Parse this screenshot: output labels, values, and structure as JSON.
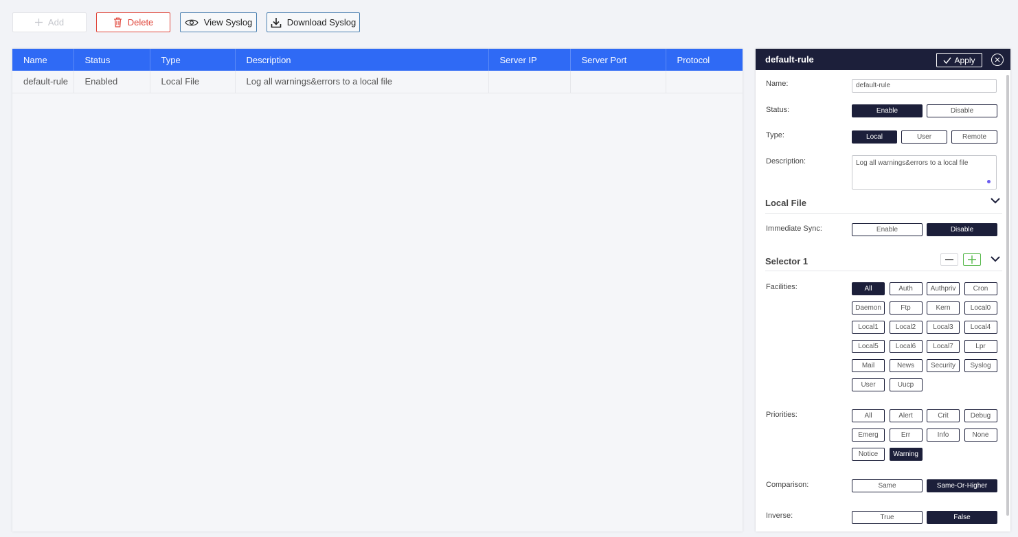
{
  "toolbar": {
    "add_label": "Add",
    "delete_label": "Delete",
    "view_label": "View Syslog",
    "download_label": "Download Syslog"
  },
  "table": {
    "columns": [
      "Name",
      "Status",
      "Type",
      "Description",
      "Server IP",
      "Server Port",
      "Protocol"
    ],
    "rows": [
      [
        "default-rule",
        "Enabled",
        "Local File",
        "Log all warnings&errors to a local file",
        "",
        "",
        ""
      ]
    ]
  },
  "panel": {
    "title": "default-rule",
    "apply_label": "Apply",
    "name_label": "Name:",
    "name_value": "default-rule",
    "status_label": "Status:",
    "status_options": [
      "Enable",
      "Disable"
    ],
    "status_selected": "Enable",
    "type_label": "Type:",
    "type_options": [
      "Local",
      "User",
      "Remote"
    ],
    "type_selected": "Local",
    "description_label": "Description:",
    "description_value": "Log all warnings&errors to a local file",
    "local_file_title": "Local File",
    "immediate_sync_label": "Immediate Sync:",
    "immediate_sync_options": [
      "Enable",
      "Disable"
    ],
    "immediate_sync_selected": "Disable",
    "selector_title": "Selector 1",
    "facilities_label": "Facilities:",
    "facilities": [
      "All",
      "Auth",
      "Authpriv",
      "Cron",
      "Daemon",
      "Ftp",
      "Kern",
      "Local0",
      "Local1",
      "Local2",
      "Local3",
      "Local4",
      "Local5",
      "Local6",
      "Local7",
      "Lpr",
      "Mail",
      "News",
      "Security",
      "Syslog",
      "User",
      "Uucp"
    ],
    "facilities_selected": [
      "All"
    ],
    "priorities_label": "Priorities:",
    "priorities": [
      "All",
      "Alert",
      "Crit",
      "Debug",
      "Emerg",
      "Err",
      "Info",
      "None",
      "Notice",
      "Warning"
    ],
    "priorities_selected": [
      "Warning"
    ],
    "comparison_label": "Comparison:",
    "comparison_options": [
      "Same",
      "Same-Or-Higher"
    ],
    "comparison_selected": "Same-Or-Higher",
    "inverse_label": "Inverse:",
    "inverse_options": [
      "True",
      "False"
    ],
    "inverse_selected": "False"
  },
  "colors": {
    "accent": "#2f6af5",
    "dark": "#1c1f3a",
    "danger": "#e0453a",
    "success": "#56b84a"
  },
  "icons": {
    "add": "plus-icon",
    "delete": "trash-icon",
    "view": "eye-icon",
    "download": "download-icon",
    "apply": "check-icon",
    "close": "close-icon",
    "collapse": "chevron-down-icon",
    "remove_selector": "minus-icon",
    "add_selector": "plus-icon"
  }
}
